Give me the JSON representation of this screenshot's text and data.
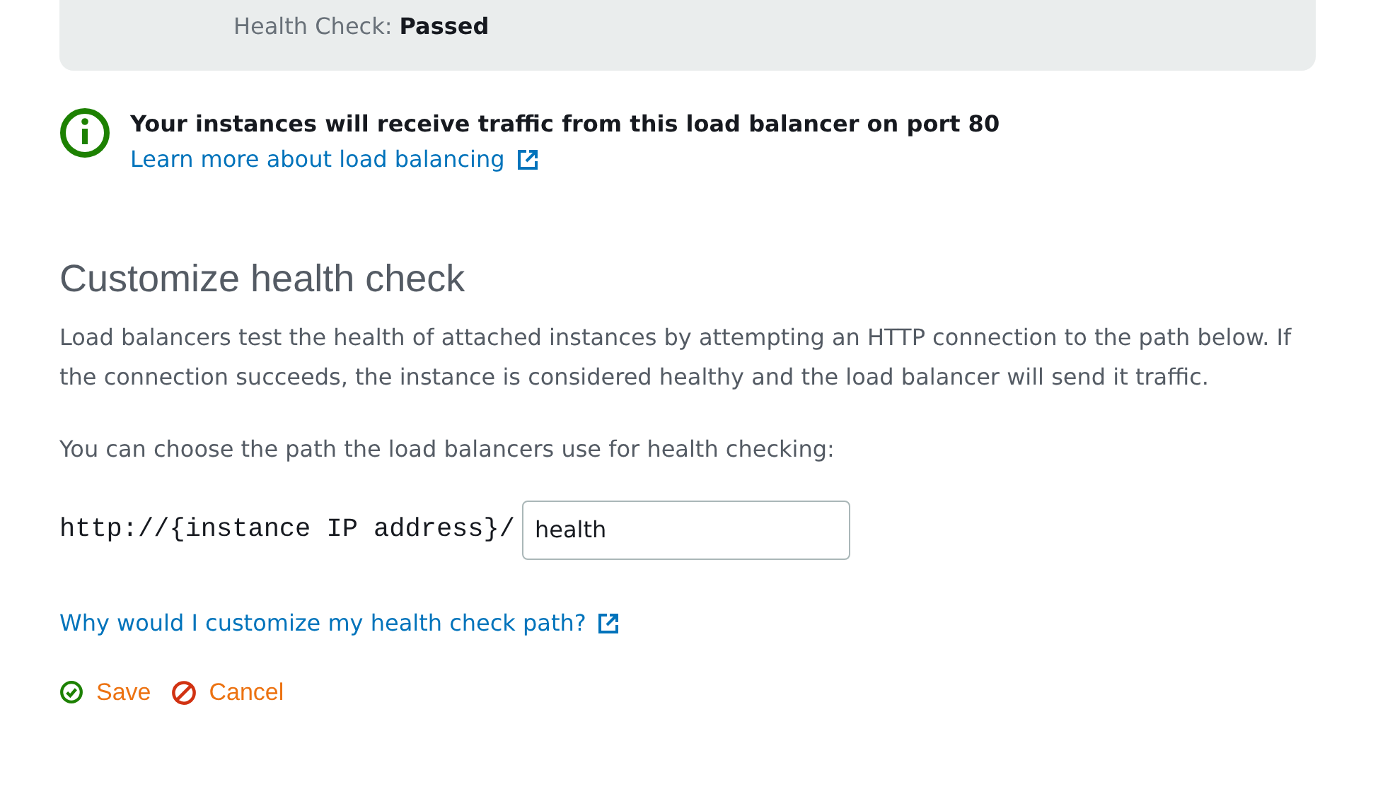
{
  "status_panel": {
    "label": "Health Check:",
    "value": "Passed"
  },
  "info": {
    "message": "Your instances will receive traffic from this load balancer on port 80",
    "link": "Learn more about load balancing"
  },
  "section": {
    "title": "Customize health check",
    "description": "Load balancers test the health of attached instances by attempting an HTTP connection to the path below. If the connection succeeds, the instance is considered healthy and the load balancer will send it traffic.",
    "prompt": "You can choose the path the load balancers use for health checking:",
    "path_prefix": "http://{instance IP address}/",
    "path_value": "health",
    "help_link": "Why would I customize my health check path?"
  },
  "actions": [
    {
      "kind": "save",
      "label": "Save"
    },
    {
      "kind": "cancel",
      "label": "Cancel"
    }
  ]
}
